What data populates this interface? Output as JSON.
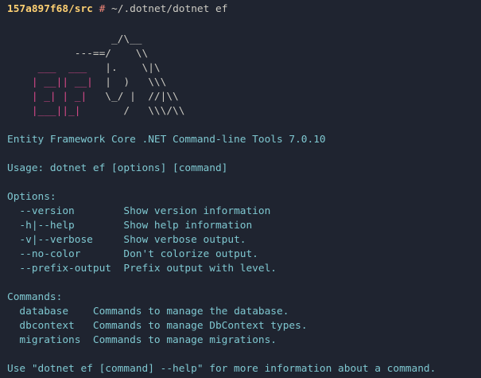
{
  "prompt": {
    "path": "157a897f68/src",
    "symbol": "#",
    "command": "~/.dotnet/dotnet ef"
  },
  "logo": {
    "line1": "                 _/\\__",
    "line2": "           ---==/    \\\\",
    "line3_pink": "     ___  ___   ",
    "line3_white": "|.    \\|\\",
    "line4_pink": "    | __|| __|  ",
    "line4_white": "|  )   \\\\\\",
    "line5_pink": "    | _| | _|   ",
    "line5_white": "\\_/ |  //|\\\\",
    "line6_pink": "    |___||_|    ",
    "line6_white": "   /   \\\\\\/\\\\"
  },
  "title": "Entity Framework Core .NET Command-line Tools 7.0.10",
  "usage": "Usage: dotnet ef [options] [command]",
  "options_header": "Options:",
  "options": [
    {
      "flag": "  --version        ",
      "desc": "Show version information"
    },
    {
      "flag": "  -h|--help        ",
      "desc": "Show help information"
    },
    {
      "flag": "  -v|--verbose     ",
      "desc": "Show verbose output."
    },
    {
      "flag": "  --no-color       ",
      "desc": "Don't colorize output."
    },
    {
      "flag": "  --prefix-output  ",
      "desc": "Prefix output with level."
    }
  ],
  "commands_header": "Commands:",
  "commands": [
    {
      "name": "  database    ",
      "desc": "Commands to manage the database."
    },
    {
      "name": "  dbcontext   ",
      "desc": "Commands to manage DbContext types."
    },
    {
      "name": "  migrations  ",
      "desc": "Commands to manage migrations."
    }
  ],
  "footer": "Use \"dotnet ef [command] --help\" for more information about a command."
}
